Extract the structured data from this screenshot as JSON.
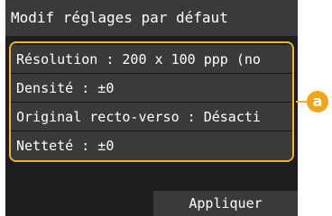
{
  "header": {
    "title": "Modif réglages par défaut"
  },
  "settings": {
    "items": [
      {
        "label": "Résolution : 200 x 100 ppp (no"
      },
      {
        "label": "Densité : ±0"
      },
      {
        "label": "Original recto-verso : Désacti"
      },
      {
        "label": "Netteté : ±0"
      }
    ]
  },
  "footer": {
    "apply_label": "Appliquer"
  },
  "callout": {
    "label": "a"
  },
  "colors": {
    "highlight": "#f2b42b",
    "callout": "#f2a51a",
    "background": "#1e1e1e",
    "row": "#3a3a3a"
  }
}
